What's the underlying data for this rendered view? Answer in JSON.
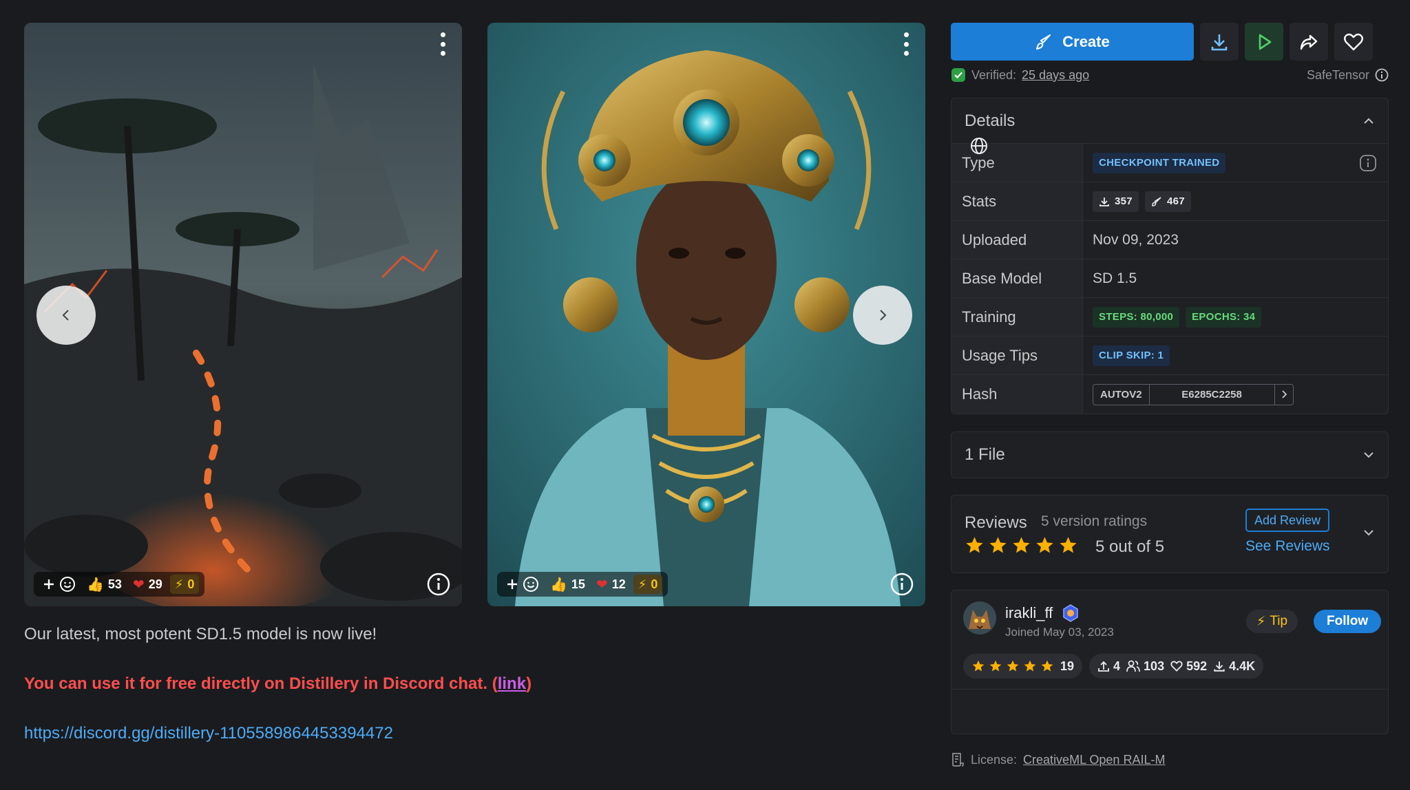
{
  "cards": [
    {
      "reactions": {
        "likes": "53",
        "hearts": "29",
        "buzz": "0"
      }
    },
    {
      "reactions": {
        "likes": "15",
        "hearts": "12",
        "buzz": "0"
      }
    }
  ],
  "description": {
    "intro": "Our latest, most potent SD1.5 model is now live!",
    "promo_text": "You can use it for free directly on Distillery in Discord chat. (",
    "promo_link": "link",
    "promo_close": ")",
    "url": "https://discord.gg/distillery-1105589864453394472"
  },
  "actions": {
    "create_label": "Create"
  },
  "verification": {
    "label": "Verified:",
    "when": "25 days ago",
    "format": "SafeTensor"
  },
  "details": {
    "title": "Details",
    "rows": {
      "type": {
        "label": "Type",
        "value": "CHECKPOINT TRAINED"
      },
      "stats": {
        "label": "Stats",
        "downloads": "357",
        "generations": "467"
      },
      "uploaded": {
        "label": "Uploaded",
        "value": "Nov 09, 2023"
      },
      "base_model": {
        "label": "Base Model",
        "value": "SD 1.5"
      },
      "training": {
        "label": "Training",
        "steps": "STEPS: 80,000",
        "epochs": "EPOCHS: 34"
      },
      "usage_tips": {
        "label": "Usage Tips",
        "value": "CLIP SKIP: 1"
      },
      "hash": {
        "label": "Hash",
        "algo": "AUTOV2",
        "value": "E6285C2258"
      }
    }
  },
  "files": {
    "title": "1 File"
  },
  "reviews": {
    "title": "Reviews",
    "count_text": "5 version ratings",
    "score_text": "5 out of 5",
    "rating": 5,
    "add_label": "Add Review",
    "see_label": "See Reviews"
  },
  "creator": {
    "username": "irakli_ff",
    "joined": "Joined May 03, 2023",
    "tip_label": "Tip",
    "follow_label": "Follow",
    "rating_count": "19",
    "uploads": "4",
    "followers": "103",
    "favorites": "592",
    "downloads": "4.4K"
  },
  "license": {
    "label": "License:",
    "name": "CreativeML Open RAIL-M"
  },
  "colors": {
    "background": "#1a1b1e",
    "panel": "#1f2024",
    "accent": "#1c7ed6",
    "link": "#4dabf7",
    "promo": "#ff4e4e",
    "star": "#fab005"
  }
}
